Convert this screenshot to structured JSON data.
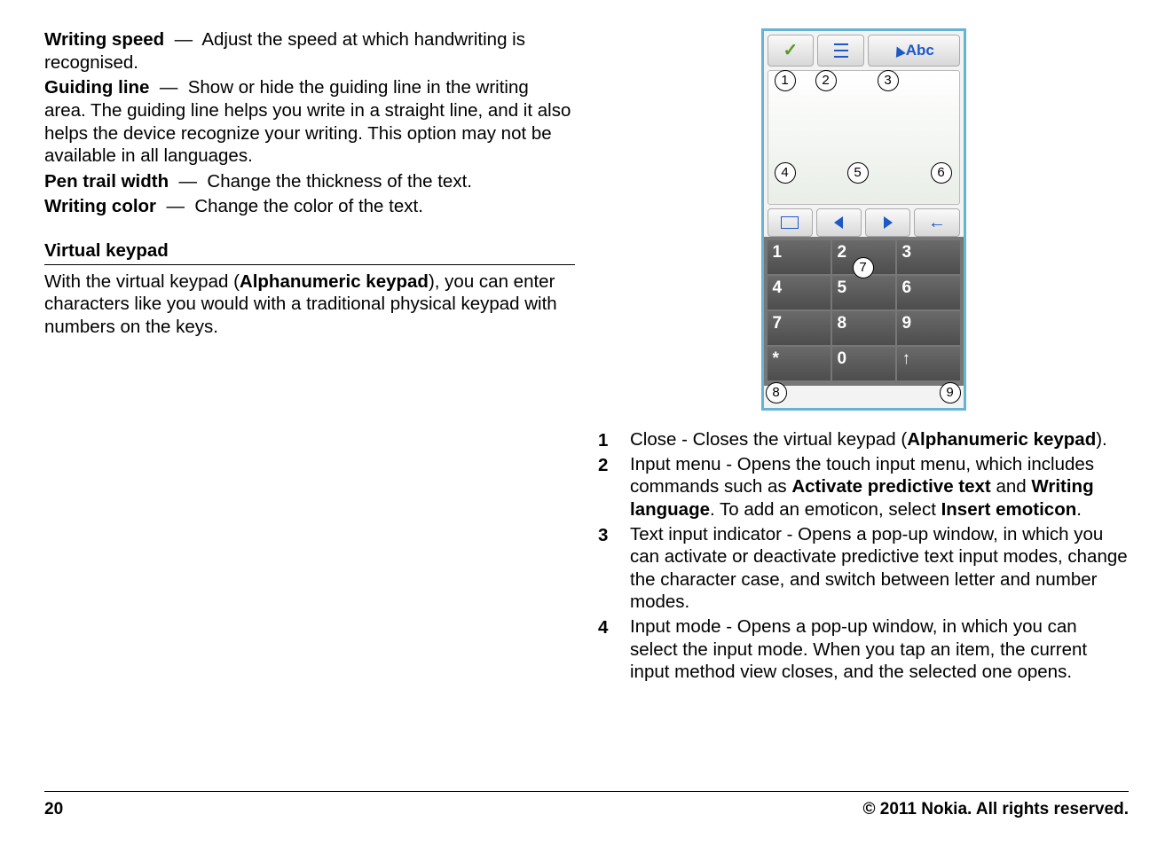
{
  "left": {
    "items": [
      {
        "label": "Writing speed",
        "text": "Adjust the speed at which handwriting is recognised."
      },
      {
        "label": "Guiding line",
        "text": "Show or hide the guiding line in the writing area. The guiding line helps you write in a straight line, and it also helps the device recognize your writing. This option may not be available in all languages."
      },
      {
        "label": "Pen trail width",
        "text": "Change the thickness of the text."
      },
      {
        "label": "Writing color",
        "text": "Change the color of the text."
      }
    ],
    "section_title": "Virtual keypad",
    "section_body_pre": "With the virtual keypad (",
    "section_body_bold": "Alphanumeric keypad",
    "section_body_post": "), you can enter characters like you would with a traditional physical keypad with numbers on the keys."
  },
  "fig": {
    "abc_label": "Abc",
    "keys": [
      "1",
      "2",
      "3",
      "4",
      "5",
      "6",
      "7",
      "8",
      "9",
      "*",
      "0",
      "↑"
    ],
    "callouts": {
      "c1": "1",
      "c2": "2",
      "c3": "3",
      "c4": "4",
      "c5": "5",
      "c6": "6",
      "c7": "7",
      "c8": "8",
      "c9": "9"
    }
  },
  "right": {
    "items": [
      {
        "n": "1",
        "html": "Close - Closes the virtual keypad (<strong>Alphanumeric keypad</strong>)."
      },
      {
        "n": "2",
        "html": "Input menu - Opens the touch input menu, which includes commands such as <strong>Activate predictive text</strong> and <strong>Writing language</strong>. To add an emoticon, select <strong>Insert emoticon</strong>."
      },
      {
        "n": "3",
        "html": "Text input indicator - Opens a pop-up window, in which you can activate or deactivate predictive text input modes, change the character case, and switch between letter and number modes."
      },
      {
        "n": "4",
        "html": "Input mode - Opens a pop-up window, in which you can select the input mode. When you tap an item, the current input method view closes, and the selected one opens."
      }
    ]
  },
  "footer": {
    "page": "20",
    "copyright": "© 2011 Nokia. All rights reserved."
  }
}
